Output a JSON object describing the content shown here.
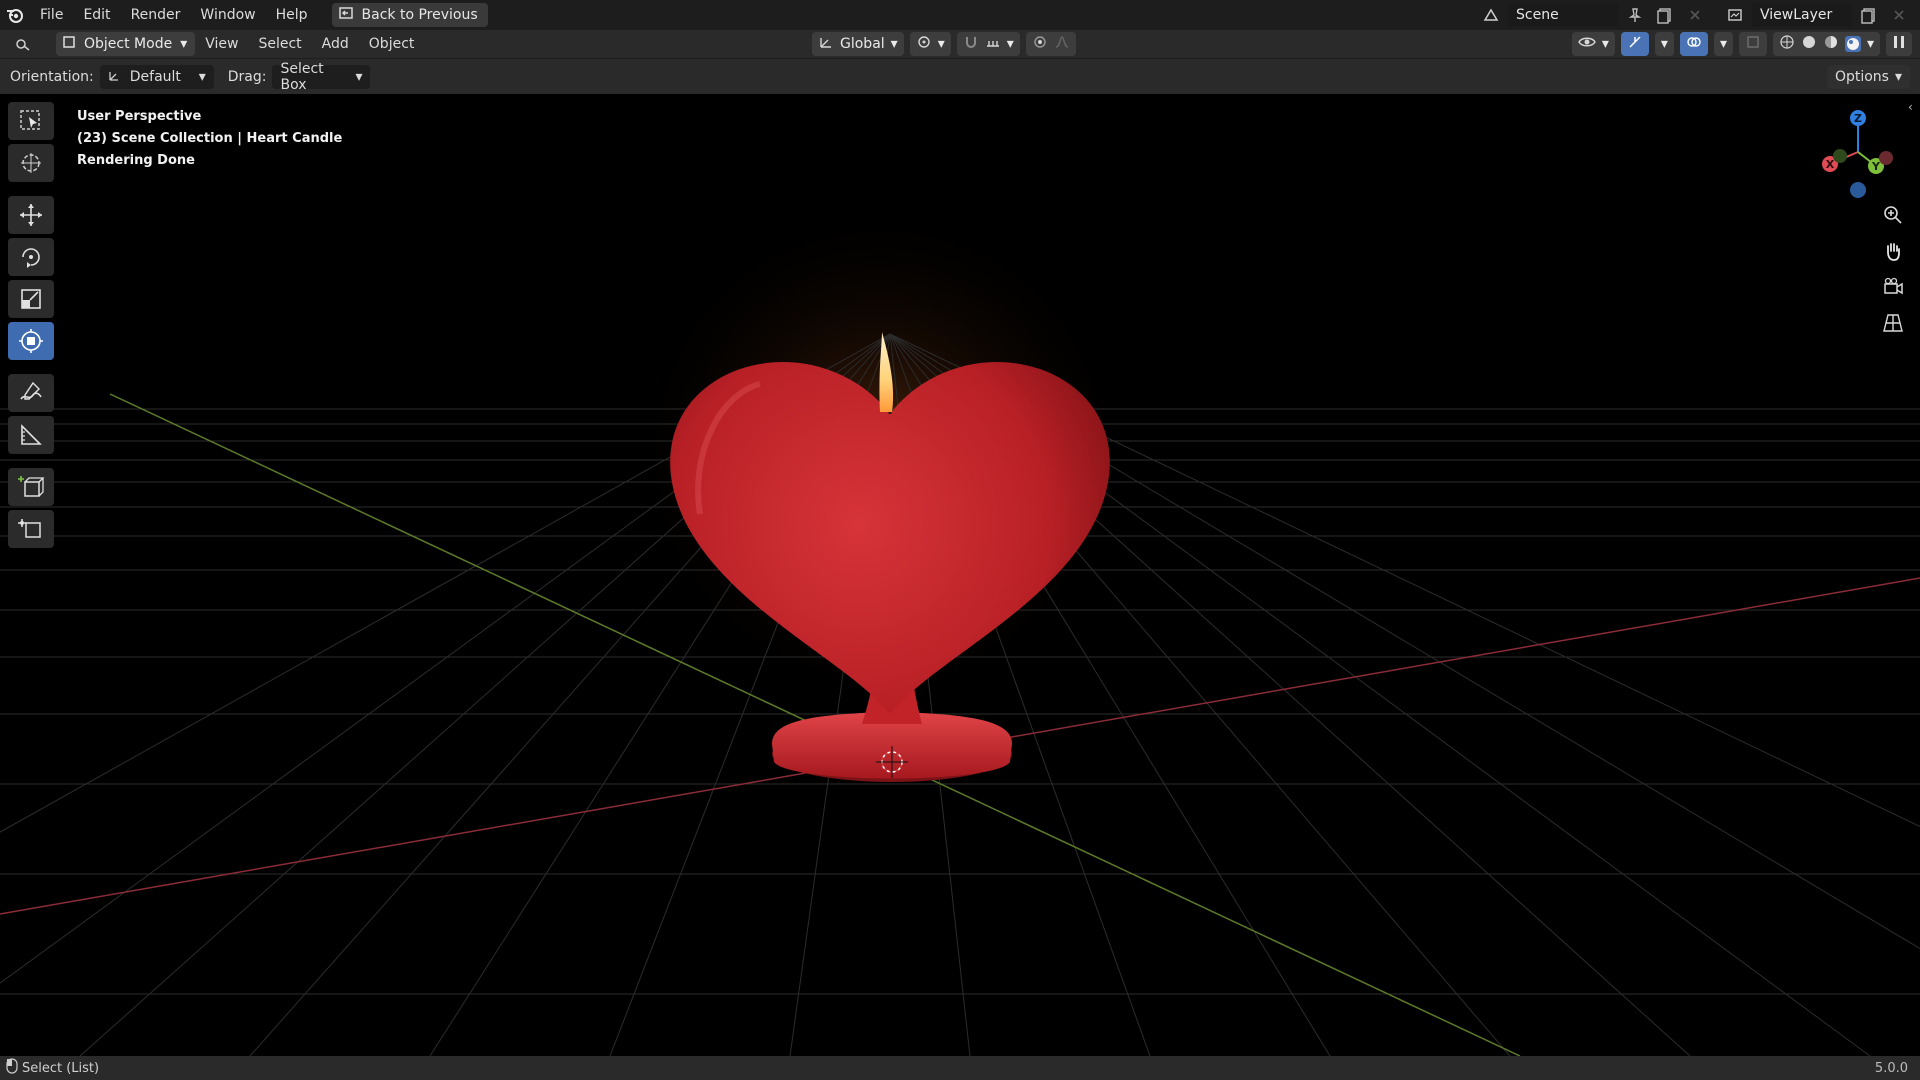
{
  "app": {
    "menu": [
      "File",
      "Edit",
      "Render",
      "Window",
      "Help"
    ],
    "back_button": "Back to Previous",
    "scene_label": "Scene",
    "view_layer_label": "ViewLayer"
  },
  "header": {
    "mode": "Object Mode",
    "menus": [
      "View",
      "Select",
      "Add",
      "Object"
    ],
    "transform_orientation": "Global"
  },
  "tool_settings": {
    "orientation_label": "Orientation:",
    "orientation_value": "Default",
    "drag_label": "Drag:",
    "drag_value": "Select Box",
    "options_label": "Options"
  },
  "viewport": {
    "overlay_lines": [
      "User Perspective",
      "(23) Scene Collection | Heart Candle",
      "Rendering Done"
    ],
    "gizmo": {
      "x": "X",
      "y": "Y",
      "z": "Z"
    }
  },
  "status": {
    "left_text": "Select (List)",
    "version": "5.0.0"
  },
  "colors": {
    "active_tool": "#3f6cb0",
    "candle_red": "#c4242a",
    "x_axis": "#e04b56",
    "y_axis": "#7fbf3b",
    "z_axis": "#2f80e0"
  }
}
